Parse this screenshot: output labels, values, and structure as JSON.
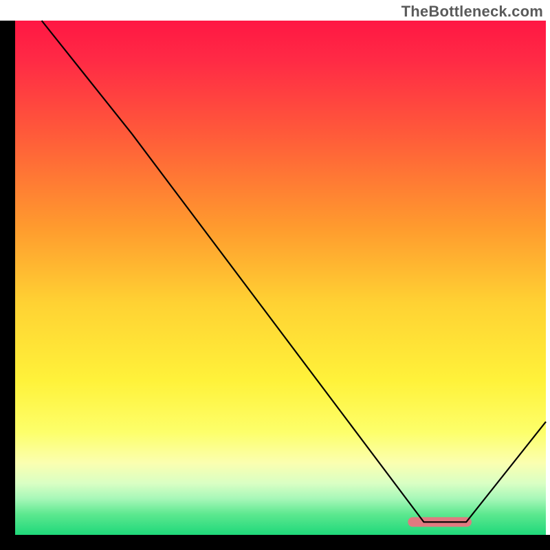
{
  "watermark": "TheBottleneck.com",
  "chart_data": {
    "type": "line",
    "title": "",
    "xlabel": "",
    "ylabel": "",
    "xlim": [
      0,
      100
    ],
    "ylim": [
      0,
      100
    ],
    "grid": false,
    "series": [
      {
        "name": "bottleneck-curve",
        "color": "#000000",
        "x": [
          5,
          22,
          77,
          85,
          100
        ],
        "y": [
          100,
          78,
          2.5,
          2.5,
          22
        ]
      }
    ],
    "background_gradient": {
      "type": "vertical",
      "stops": [
        {
          "pos": 0.0,
          "color": "#ff1744"
        },
        {
          "pos": 0.08,
          "color": "#ff2b45"
        },
        {
          "pos": 0.22,
          "color": "#ff5a3a"
        },
        {
          "pos": 0.4,
          "color": "#ff9a2e"
        },
        {
          "pos": 0.55,
          "color": "#ffd233"
        },
        {
          "pos": 0.7,
          "color": "#fff23a"
        },
        {
          "pos": 0.8,
          "color": "#fdff6a"
        },
        {
          "pos": 0.86,
          "color": "#fbffb0"
        },
        {
          "pos": 0.9,
          "color": "#d9ffc4"
        },
        {
          "pos": 0.93,
          "color": "#a6f7b8"
        },
        {
          "pos": 0.96,
          "color": "#5ce88f"
        },
        {
          "pos": 1.0,
          "color": "#1fd87a"
        }
      ]
    },
    "marker": {
      "name": "optimal-range",
      "shape": "rounded-bar",
      "color": "#e07a80",
      "x_range": [
        74,
        86
      ],
      "y": 2.5
    },
    "axes": {
      "left": {
        "visible": true,
        "thickness": 22,
        "color": "#000000"
      },
      "bottom": {
        "visible": true,
        "thickness": 22,
        "color": "#000000"
      },
      "ticks": "none",
      "labels": "none"
    }
  }
}
